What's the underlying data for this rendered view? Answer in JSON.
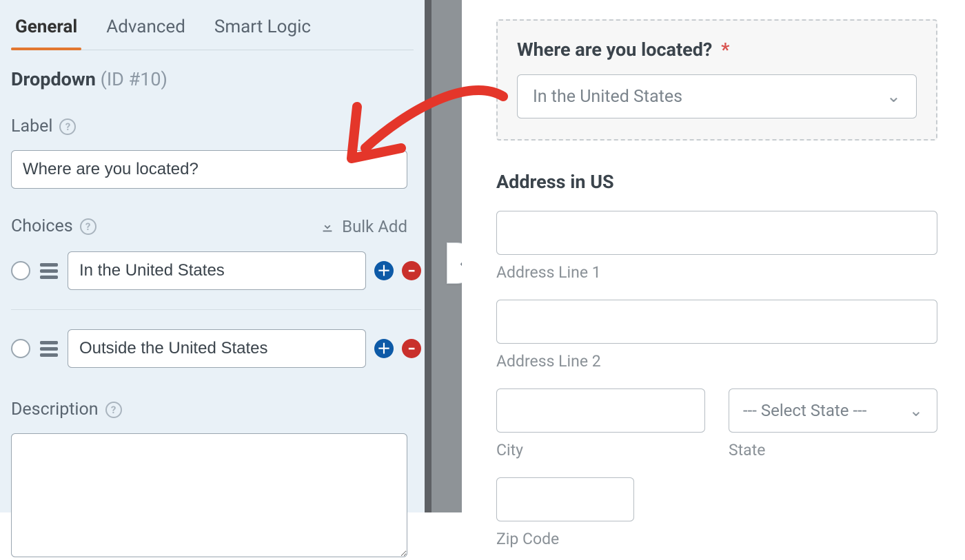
{
  "tabs": {
    "general": "General",
    "advanced": "Advanced",
    "smart": "Smart Logic"
  },
  "editor": {
    "field_type": "Dropdown",
    "id_text": "(ID #10)",
    "label_heading": "Label",
    "label_value": "Where are you located?",
    "choices_heading": "Choices",
    "bulk_add": "Bulk Add",
    "choices": [
      {
        "value": "In the United States"
      },
      {
        "value": "Outside the United States"
      }
    ],
    "description_heading": "Description",
    "description_value": ""
  },
  "preview": {
    "question": "Where are you located?",
    "selected": "In the United States",
    "address_section": "Address in US",
    "line1": "Address Line 1",
    "line2": "Address Line 2",
    "city": "City",
    "state": "State",
    "state_placeholder": "--- Select State ---",
    "zip": "Zip Code"
  }
}
